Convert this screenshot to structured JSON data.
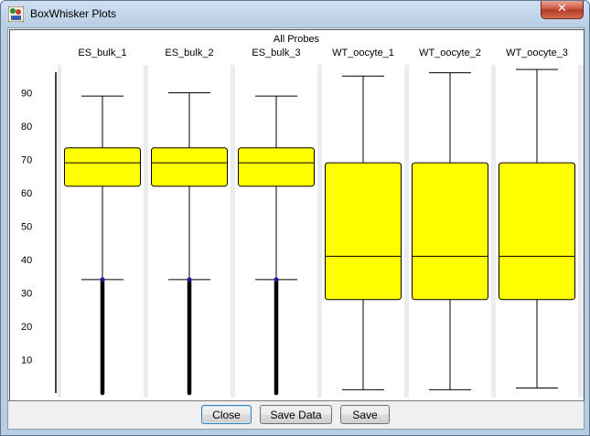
{
  "window": {
    "title": "BoxWhisker Plots",
    "close_glyph": "✕"
  },
  "buttons": {
    "close": "Close",
    "save_data": "Save Data",
    "save": "Save"
  },
  "chart_data": {
    "type": "box",
    "title": "All Probes",
    "yticks": [
      10,
      20,
      30,
      40,
      50,
      60,
      70,
      80,
      90
    ],
    "ylim": [
      0,
      98
    ],
    "categories": [
      "ES_bulk_1",
      "ES_bulk_2",
      "ES_bulk_3",
      "WT_oocyte_1",
      "WT_oocyte_2",
      "WT_oocyte_3"
    ],
    "boxes": [
      {
        "name": "ES_bulk_1",
        "whisker_low": 34,
        "q1": 62,
        "median": 69,
        "q3": 73.5,
        "whisker_high": 89,
        "outliers_low": [
          0,
          34
        ]
      },
      {
        "name": "ES_bulk_2",
        "whisker_low": 34,
        "q1": 62,
        "median": 69,
        "q3": 73.5,
        "whisker_high": 90,
        "outliers_low": [
          0,
          34
        ]
      },
      {
        "name": "ES_bulk_3",
        "whisker_low": 34,
        "q1": 62,
        "median": 69,
        "q3": 73.5,
        "whisker_high": 89,
        "outliers_low": [
          0,
          34
        ]
      },
      {
        "name": "WT_oocyte_1",
        "whisker_low": 1,
        "q1": 28,
        "median": 41,
        "q3": 69,
        "whisker_high": 95
      },
      {
        "name": "WT_oocyte_2",
        "whisker_low": 1,
        "q1": 28,
        "median": 41,
        "q3": 69,
        "whisker_high": 96
      },
      {
        "name": "WT_oocyte_3",
        "whisker_low": 1.5,
        "q1": 28,
        "median": 41,
        "q3": 69,
        "whisker_high": 97
      }
    ],
    "box_color": "#ffff00",
    "column_bg": "#ffffff",
    "gap_color": "#ececec",
    "outlier_color": "#000000",
    "marker_color": "#1a1aa0",
    "grid": false
  }
}
